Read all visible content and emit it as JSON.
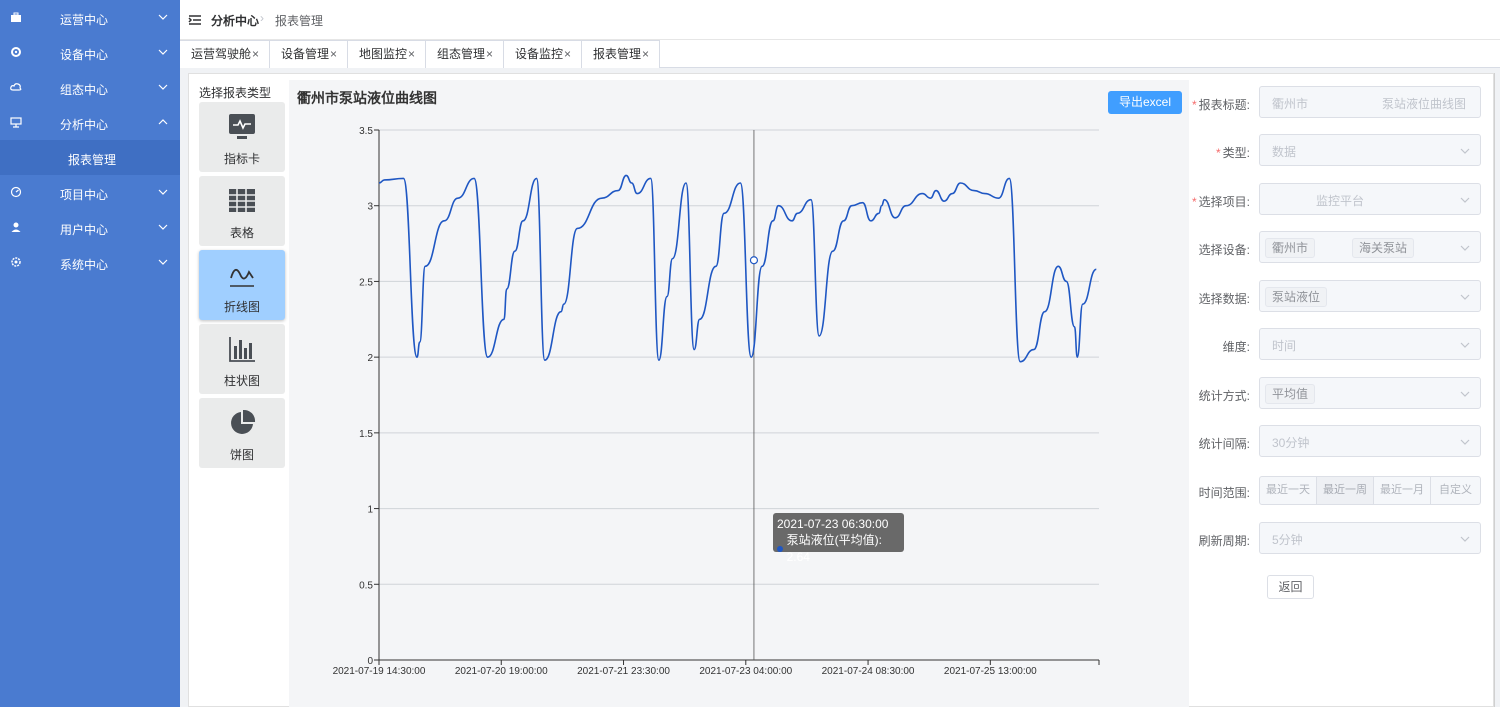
{
  "sidebar": {
    "items": [
      {
        "label": "运营中心",
        "icon": "briefcase-icon",
        "expanded": false
      },
      {
        "label": "设备中心",
        "icon": "gear-icon",
        "expanded": false
      },
      {
        "label": "组态中心",
        "icon": "cloud-icon",
        "expanded": false
      },
      {
        "label": "分析中心",
        "icon": "presentation-icon",
        "expanded": true
      },
      {
        "label": "项目中心",
        "icon": "dashboard-icon",
        "expanded": false
      },
      {
        "label": "用户中心",
        "icon": "user-icon",
        "expanded": false
      },
      {
        "label": "系统中心",
        "icon": "settings-icon",
        "expanded": false
      }
    ],
    "sub_item": {
      "label": "报表管理"
    }
  },
  "header": {
    "breadcrumb_1": "分析中心",
    "breadcrumb_2": "报表管理"
  },
  "tabs": [
    {
      "label": "运营驾驶舱"
    },
    {
      "label": "设备管理"
    },
    {
      "label": "地图监控"
    },
    {
      "label": "组态管理"
    },
    {
      "label": "设备监控"
    },
    {
      "label": "报表管理"
    }
  ],
  "tab_close": "×",
  "report_types": {
    "title": "选择报表类型",
    "items": [
      {
        "label": "指标卡",
        "icon": "monitor-icon"
      },
      {
        "label": "表格",
        "icon": "table-icon"
      },
      {
        "label": "折线图",
        "icon": "line-wave-icon",
        "active": true
      },
      {
        "label": "柱状图",
        "icon": "bar-chart-icon"
      },
      {
        "label": "饼图",
        "icon": "pie-chart-icon"
      }
    ]
  },
  "export_label": "导出excel",
  "chart_data": {
    "type": "line",
    "title": "衢州市",
    "title_tail": "泵站液位曲线图",
    "series": [
      {
        "name": "泵站液位(平均值)",
        "color": "#1f57c3",
        "x": [
          0,
          2,
          9,
          14,
          15,
          17,
          24,
          29,
          35,
          40,
          46,
          47,
          50,
          53,
          58,
          61,
          67,
          68,
          73,
          82,
          88,
          91,
          93,
          95,
          100,
          103,
          106,
          108,
          113,
          116,
          118,
          124,
          127,
          133,
          137,
          141,
          145,
          147,
          152,
          154,
          159,
          162,
          167,
          171,
          174,
          178,
          181,
          184,
          185,
          186,
          190,
          194,
          200,
          203,
          205,
          208,
          211,
          214,
          219,
          223,
          228,
          232,
          236,
          241,
          245,
          250,
          253,
          256,
          257,
          259,
          264
        ],
        "y": [
          3.15,
          3.17,
          3.18,
          2.0,
          2.1,
          2.6,
          2.9,
          3.05,
          3.18,
          2.0,
          2.25,
          2.45,
          2.7,
          2.9,
          3.18,
          1.98,
          2.3,
          2.35,
          2.85,
          3.05,
          3.1,
          3.2,
          3.15,
          3.08,
          3.18,
          1.98,
          2.4,
          2.65,
          3.15,
          2.05,
          2.25,
          2.6,
          2.95,
          3.15,
          2.0,
          2.6,
          2.9,
          3.0,
          2.9,
          2.95,
          3.04,
          2.14,
          2.7,
          2.9,
          3.0,
          3.02,
          2.9,
          2.95,
          3.0,
          3.04,
          2.92,
          3.0,
          3.08,
          3.05,
          3.1,
          3.03,
          3.08,
          3.15,
          3.1,
          3.08,
          3.05,
          3.18,
          1.97,
          2.05,
          2.3,
          2.6,
          2.5,
          2.2,
          2.0,
          2.35,
          2.58
        ]
      }
    ],
    "x_tick_labels": [
      "2021-07-19 14:30:00",
      "2021-07-20 19:00:00",
      "2021-07-21 23:30:00",
      "2021-07-23 04:00:00",
      "2021-07-24 08:30:00",
      "2021-07-25 13:00:00"
    ],
    "x_tick_positions": [
      0,
      45,
      90,
      135,
      180,
      225
    ],
    "x_max": 265,
    "ylim": [
      0,
      3.5
    ],
    "y_ticks": [
      0,
      0.5,
      1,
      1.5,
      2,
      2.5,
      3,
      3.5
    ],
    "grid": true,
    "cursor_x": 138,
    "cursor_y": 2.64
  },
  "tooltip": {
    "time": "2021-07-23 06:30:00",
    "label": "泵站液位(平均值): 2.64"
  },
  "form": {
    "report_title_label": "报表标题:",
    "report_title_value_1": "衢州市",
    "report_title_value_2": "泵站液位曲线图",
    "type_label": "类型:",
    "type_value": "数据",
    "project_label": "选择项目:",
    "project_value": "监控平台",
    "device_label": "选择设备:",
    "device_tag_1": "衢州市",
    "device_tag_2": "海关泵站",
    "data_label": "选择数据:",
    "data_tag": "泵站液位",
    "dimension_label": "维度:",
    "dimension_value": "时间",
    "stat_method_label": "统计方式:",
    "stat_method_tag": "平均值",
    "interval_label": "统计间隔:",
    "interval_value": "30分钟",
    "time_range_label": "时间范围:",
    "time_range_options": [
      "最近一天",
      "最近一周",
      "最近一月",
      "自定义"
    ],
    "time_range_selected": "最近一周",
    "refresh_label": "刷新周期:",
    "refresh_value": "5分钟",
    "back_label": "返回"
  }
}
